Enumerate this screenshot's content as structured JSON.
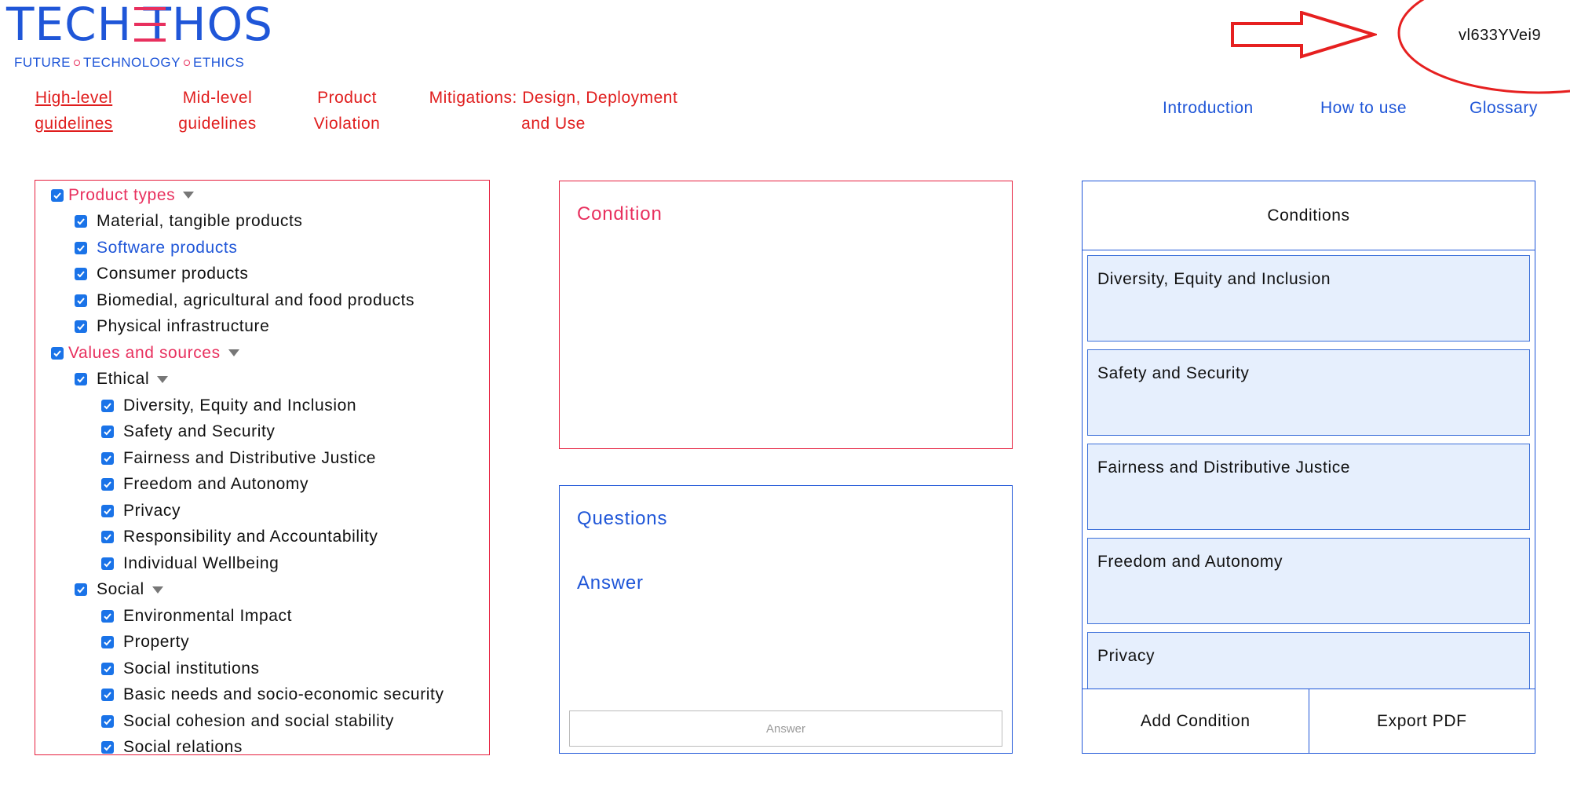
{
  "logo": {
    "wordmark_left": "TECH",
    "wordmark_right": "THOS",
    "tagline": [
      "FUTURE",
      "TECHNOLOGY",
      "ETHICS"
    ]
  },
  "session_id": "vl633YVei9",
  "nav_left": [
    {
      "label_line1": "High-level",
      "label_line2": "guidelines",
      "active": true
    },
    {
      "label_line1": "Mid-level",
      "label_line2": "guidelines"
    },
    {
      "label_line1": "Product",
      "label_line2": "Violation"
    },
    {
      "label_line1": "Mitigations: Design, Deployment",
      "label_line2": "and Use"
    }
  ],
  "nav_right": [
    "Introduction",
    "How to use",
    "Glossary"
  ],
  "filter_tree": [
    {
      "label": "Product types",
      "level": 0,
      "section": true
    },
    {
      "label": "Material, tangible products",
      "level": 1
    },
    {
      "label": "Software products",
      "level": 1,
      "highlight": true
    },
    {
      "label": "Consumer products",
      "level": 1
    },
    {
      "label": "Biomedial, agricultural and food products",
      "level": 1
    },
    {
      "label": "Physical infrastructure",
      "level": 1
    },
    {
      "label": "Values and sources",
      "level": 0,
      "section": true
    },
    {
      "label": "Ethical",
      "level": 1,
      "expandable": true
    },
    {
      "label": "Diversity, Equity and Inclusion",
      "level": 2
    },
    {
      "label": "Safety and Security",
      "level": 2
    },
    {
      "label": "Fairness and Distributive Justice",
      "level": 2
    },
    {
      "label": "Freedom and Autonomy",
      "level": 2
    },
    {
      "label": "Privacy",
      "level": 2
    },
    {
      "label": "Responsibility and Accountability",
      "level": 2
    },
    {
      "label": "Individual Wellbeing",
      "level": 2
    },
    {
      "label": "Social",
      "level": 1,
      "expandable": true
    },
    {
      "label": "Environmental Impact",
      "level": 2
    },
    {
      "label": "Property",
      "level": 2
    },
    {
      "label": "Social institutions",
      "level": 2
    },
    {
      "label": "Basic needs and socio-economic security",
      "level": 2
    },
    {
      "label": "Social cohesion and social stability",
      "level": 2
    },
    {
      "label": "Social relations",
      "level": 2
    }
  ],
  "condition_panel": {
    "title": "Condition"
  },
  "questions_panel": {
    "questions_title": "Questions",
    "answer_title": "Answer",
    "answer_placeholder": "Answer"
  },
  "conditions_panel": {
    "header": "Conditions",
    "items": [
      "Diversity, Equity and Inclusion",
      "Safety and Security",
      "Fairness and Distributive Justice",
      "Freedom and Autonomy",
      "Privacy"
    ],
    "add_label": "Add Condition",
    "export_label": "Export PDF"
  },
  "colors": {
    "brand_blue": "#1f56d8",
    "brand_pink": "#e8305e",
    "nav_red": "#e01d1d",
    "card_bg": "#e6effd"
  }
}
